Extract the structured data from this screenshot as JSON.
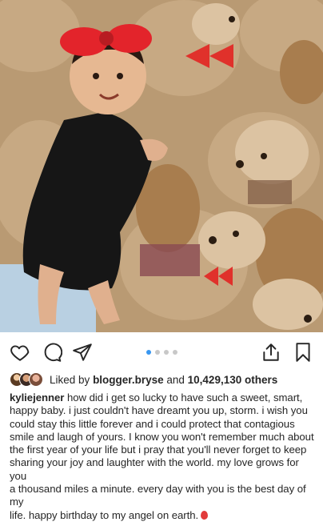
{
  "post": {
    "liked_by_prefix": "Liked by",
    "liked_by_user": "blogger.bryse",
    "liked_by_and": "and",
    "liked_by_count": "10,429,130 others",
    "caption_user": "kyliejenner",
    "caption_text": " how did i get so lucky to have such a sweet, smart,\nhappy baby. i just couldn't have dreamt you up, storm. i wish you\ncould stay this little forever and i could protect that contagious\nsmile and laugh of yours. I know you won't remember much about\nthe first year of your life but i pray that you'll never forget to keep\nsharing your joy and laughter with the world. my love grows for you\na thousand miles a minute. every day with you is the best day of my\nlife. happy birthday to my angel on earth.",
    "caption_emoji": "balloon",
    "carousel": {
      "count": 4,
      "active": 1
    }
  },
  "icons": [
    "heart-icon",
    "comment-icon",
    "share-icon",
    "upload-icon",
    "bookmark-icon"
  ],
  "colors": {
    "accent": "#3897f0",
    "text": "#262626",
    "balloon": "#e23b3b"
  }
}
